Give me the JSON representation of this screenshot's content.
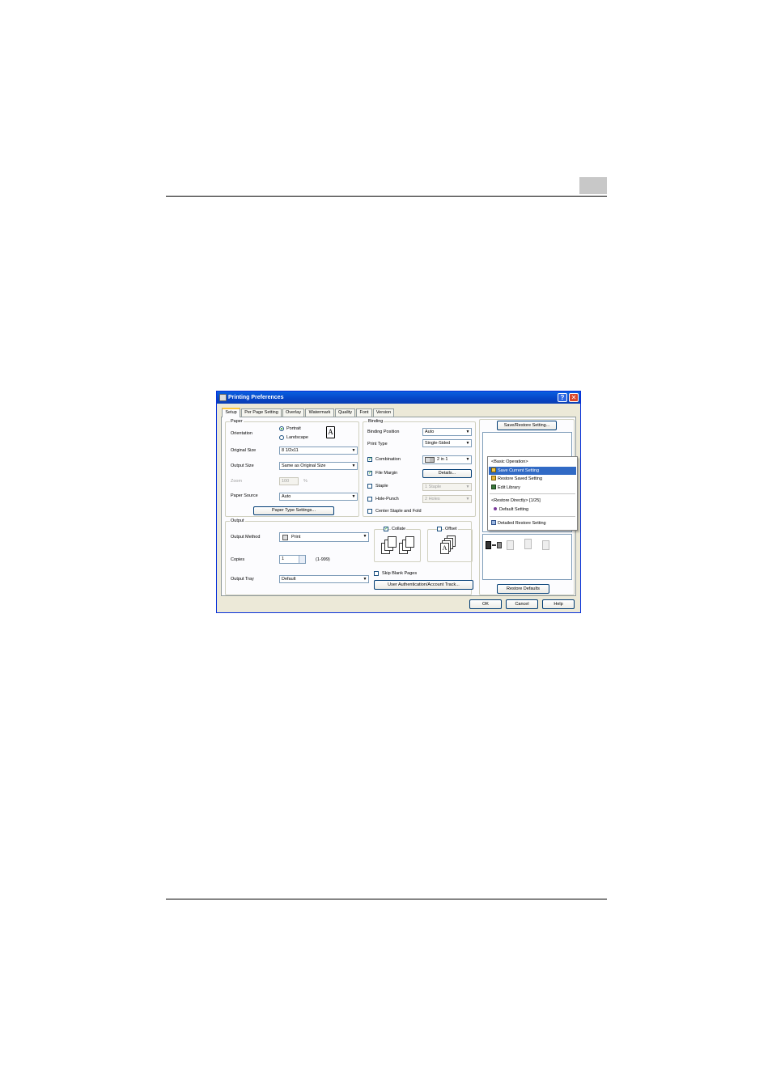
{
  "window": {
    "title": "Printing Preferences",
    "help_glyph": "?",
    "close_glyph": "✕"
  },
  "tabs": [
    "Setup",
    "Per Page Setting",
    "Overlay",
    "Watermark",
    "Quality",
    "Font",
    "Version"
  ],
  "active_tab": "Setup",
  "paper": {
    "group_label": "Paper",
    "orientation_label": "Orientation",
    "portrait_label": "Portrait",
    "landscape_label": "Landscape",
    "orientation_selected": "Portrait",
    "orientation_glyph": "A",
    "original_size_label": "Original Size",
    "original_size_value": "8 1/2x11",
    "output_size_label": "Output Size",
    "output_size_value": "Same as Original Size",
    "zoom_label": "Zoom",
    "zoom_value": "100",
    "zoom_unit": "%",
    "paper_source_label": "Paper Source",
    "paper_source_value": "Auto",
    "paper_type_button": "Paper Type Settings..."
  },
  "binding": {
    "group_label": "Binding",
    "binding_position_label": "Binding Position",
    "binding_position_value": "Auto",
    "print_type_label": "Print Type",
    "print_type_value": "Single-Sided",
    "combination_label": "Combination",
    "combination_checked": true,
    "combination_value": "2 in 1",
    "file_margin_label": "File Margin",
    "file_margin_checked": true,
    "details_button": "Details...",
    "staple_label": "Staple",
    "staple_checked": false,
    "staple_value": "1 Staple",
    "hole_punch_label": "Hole-Punch",
    "hole_punch_checked": false,
    "hole_punch_value": "2 Holes",
    "center_staple_label": "Center Staple and Fold",
    "center_staple_checked": false
  },
  "output": {
    "group_label": "Output",
    "output_method_label": "Output Method",
    "output_method_value": "Print",
    "copies_label": "Copies",
    "copies_value": "1",
    "copies_range": "(1-999)",
    "output_tray_label": "Output Tray",
    "output_tray_value": "Default",
    "collate_label": "Collate",
    "collate_checked": true,
    "offset_label": "Offset",
    "offset_checked": false,
    "skip_blank_label": "Skip Blank Pages",
    "skip_blank_checked": false,
    "user_auth_button": "User Authentication/Account Track..."
  },
  "right_panel": {
    "save_restore_button": "Save/Restore Setting...",
    "restore_defaults_button": "Restore Defaults"
  },
  "menu": {
    "basic_header": "<Basic Operation>",
    "save_current": "Save Current Setting",
    "restore_saved": "Restore Saved Setting",
    "edit_library": "Edit Library",
    "restore_directly_header": "<Restore Directly>  [1/25]",
    "default_setting": "Default Setting",
    "detailed_restore": "Detailed Restore Setting",
    "highlighted_item": "Save Current Setting"
  },
  "footer": {
    "ok": "OK",
    "cancel": "Cancel",
    "help": "Help"
  },
  "check_glyph": "✓",
  "dropdown_glyph": "▼",
  "colors": {
    "titlebar": "#0544c6",
    "menu_highlight": "#316ac5",
    "dialog_bg": "#ece9d8",
    "page_rule": "#000000",
    "chapter_box": "#c8c8c8"
  }
}
